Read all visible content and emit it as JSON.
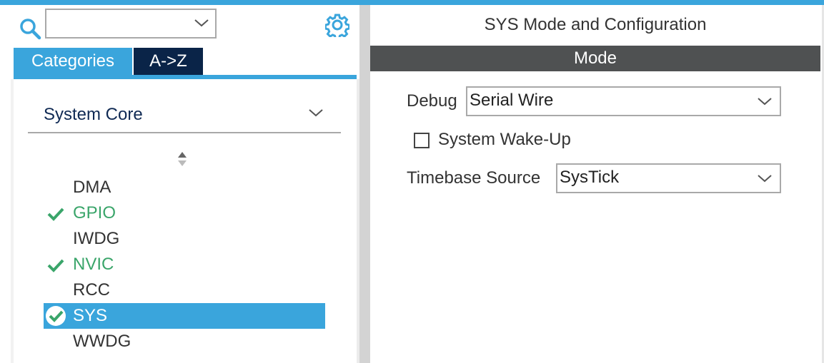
{
  "left_panel": {
    "search": {
      "value": "",
      "search_icon": "search-icon",
      "settings_icon": "gear-icon"
    },
    "tabs": [
      {
        "label": "Categories",
        "active": true
      },
      {
        "label": "A->Z",
        "active": false
      }
    ],
    "category_dropdown": {
      "selected": "System Core"
    },
    "items": [
      {
        "label": "DMA",
        "status": "none"
      },
      {
        "label": "GPIO",
        "status": "enabled"
      },
      {
        "label": "IWDG",
        "status": "none"
      },
      {
        "label": "NVIC",
        "status": "enabled"
      },
      {
        "label": "RCC",
        "status": "none"
      },
      {
        "label": "SYS",
        "status": "selected"
      },
      {
        "label": "WWDG",
        "status": "none"
      }
    ]
  },
  "right_panel": {
    "title": "SYS Mode and Configuration",
    "mode_header": "Mode",
    "debug": {
      "label": "Debug",
      "value": "Serial Wire"
    },
    "system_wakeup": {
      "label": "System Wake-Up",
      "checked": false
    },
    "timebase": {
      "label": "Timebase Source",
      "value": "SysTick"
    }
  },
  "colors": {
    "accent_blue": "#3aa5dc",
    "dark_navy": "#0a2448",
    "mode_bar": "#4f5152",
    "enabled_green": "#3aa56a"
  }
}
